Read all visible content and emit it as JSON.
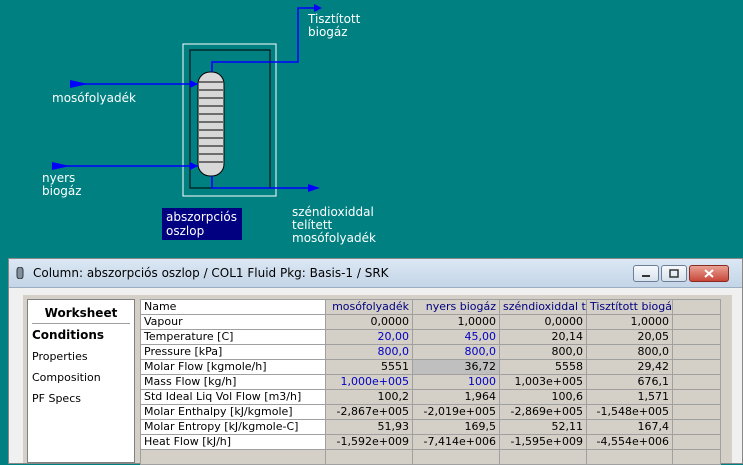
{
  "pfd": {
    "streams": {
      "top_product": "Tisztított\nbiogáz",
      "solvent_feed": "mosófolyadék",
      "gas_feed": "nyers\nbiogáz",
      "bottom_product": "széndioxiddal\ntelített\nmosófolyadék"
    },
    "unit_label": "abszorpciós\noszlop",
    "colors": {
      "background": "#008080",
      "stream": "#0000ff",
      "label_bg": "#000080"
    }
  },
  "window": {
    "title": "Column: abszorpciós oszlop / COL1  Fluid Pkg: Basis-1 / SRK",
    "buttons": [
      "minimize",
      "maximize",
      "close"
    ]
  },
  "nav": {
    "header": "Worksheet",
    "items": [
      "Conditions",
      "Properties",
      "Composition",
      "PF Specs"
    ],
    "active": "Conditions"
  },
  "table": {
    "header": "Name",
    "columns": [
      "mosófolyadék",
      "nyers biogáz",
      "széndioxiddal te",
      "Tisztított biogáz"
    ],
    "rows": [
      {
        "label": "Vapour",
        "values": [
          "0,0000",
          "1,0000",
          "0,0000",
          "1,0000"
        ]
      },
      {
        "label": "Temperature [C]",
        "values": [
          "20,00",
          "45,00",
          "20,14",
          "20,05"
        ]
      },
      {
        "label": "Pressure [kPa]",
        "values": [
          "800,0",
          "800,0",
          "800,0",
          "800,0"
        ]
      },
      {
        "label": "Molar Flow [kgmole/h]",
        "values": [
          "5551",
          "36,72",
          "5558",
          "29,42"
        ]
      },
      {
        "label": "Mass Flow [kg/h]",
        "values": [
          "1,000e+005",
          "1000",
          "1,003e+005",
          "676,1"
        ]
      },
      {
        "label": "Std Ideal Liq Vol Flow [m3/h]",
        "values": [
          "100,2",
          "1,964",
          "100,6",
          "1,571"
        ]
      },
      {
        "label": "Molar Enthalpy [kJ/kgmole]",
        "values": [
          "-2,867e+005",
          "-2,019e+005",
          "-2,869e+005",
          "-1,548e+005"
        ]
      },
      {
        "label": "Molar Entropy [kJ/kgmole-C]",
        "values": [
          "51,93",
          "169,5",
          "52,11",
          "167,4"
        ]
      },
      {
        "label": "Heat Flow [kJ/h]",
        "values": [
          "-1,592e+009",
          "-7,414e+006",
          "-1,595e+009",
          "-4,554e+006"
        ]
      }
    ]
  }
}
